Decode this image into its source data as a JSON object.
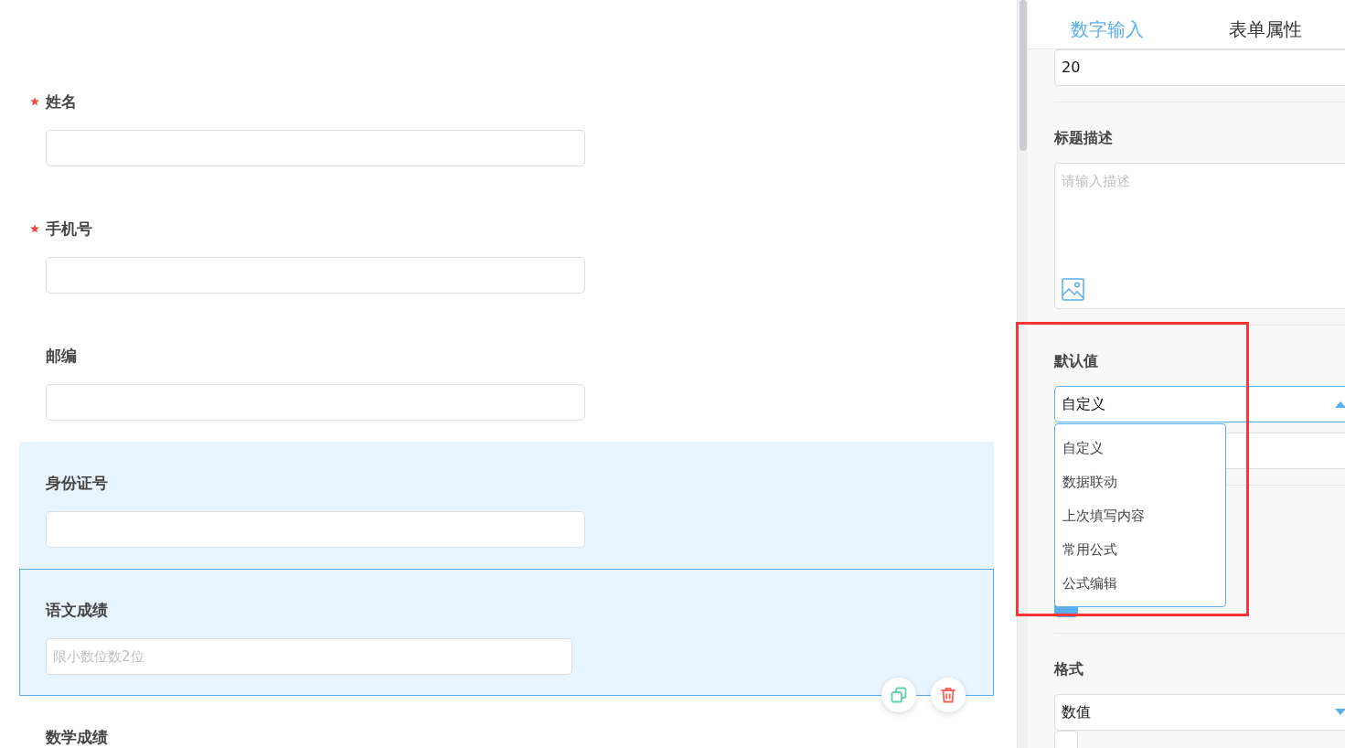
{
  "canvas": {
    "fields": [
      {
        "label": "姓名",
        "required": true,
        "hovered": false,
        "selected": false
      },
      {
        "label": "手机号",
        "required": true,
        "hovered": false,
        "selected": false
      },
      {
        "label": "邮编",
        "required": false,
        "hovered": false,
        "selected": false
      },
      {
        "label": "身份证号",
        "required": false,
        "hovered": true,
        "selected": false
      },
      {
        "label": "语文成绩",
        "required": false,
        "hovered": false,
        "selected": true,
        "placeholder": "限小数位数2位"
      },
      {
        "label": "数学成绩",
        "required": false,
        "hovered": false,
        "selected": false,
        "input_hidden": true
      }
    ]
  },
  "panel": {
    "tabs": [
      {
        "label": "数字输入",
        "selected": true
      },
      {
        "label": "表单属性",
        "selected": false
      }
    ],
    "groups": [
      {
        "controls": [
          {
            "kind": "input",
            "value": "20"
          }
        ]
      },
      {
        "label": "标题描述",
        "controls": [
          {
            "kind": "textarea",
            "placeholder": "请输入描述"
          }
        ]
      },
      {
        "label": "默认值",
        "controls": [
          {
            "kind": "select",
            "value": "自定义",
            "open": true,
            "options": [
              "自定义",
              "数据联动",
              "上次填写内容",
              "常用公式",
              "公式编辑"
            ]
          },
          {
            "kind": "input"
          }
        ]
      },
      {
        "controls": [
          {
            "kind": "checkbox",
            "checked": true
          }
        ]
      },
      {
        "label": "格式",
        "controls": [
          {
            "kind": "select",
            "value": "数值",
            "open": false
          },
          {
            "kind": "checkbox",
            "checked": false
          }
        ]
      }
    ]
  }
}
